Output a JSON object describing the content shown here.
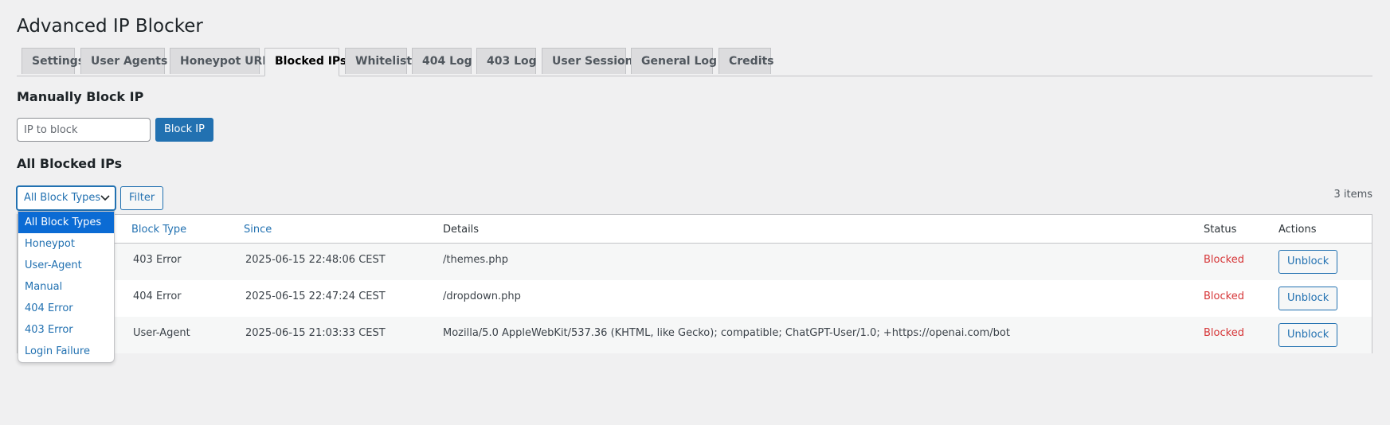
{
  "page_title": "Advanced IP Blocker",
  "tabs": [
    {
      "label": "Settings",
      "active": false
    },
    {
      "label": "User Agents",
      "active": false
    },
    {
      "label": "Honeypot URLs",
      "active": false
    },
    {
      "label": "Blocked IPs",
      "active": true
    },
    {
      "label": "Whitelist",
      "active": false
    },
    {
      "label": "404 Log",
      "active": false
    },
    {
      "label": "403 Log",
      "active": false
    },
    {
      "label": "User Sessions",
      "active": false
    },
    {
      "label": "General Log",
      "active": false
    },
    {
      "label": "Credits",
      "active": false
    }
  ],
  "manual_block": {
    "heading": "Manually Block IP",
    "input_placeholder": "IP to block",
    "input_value": "",
    "button_label": "Block IP"
  },
  "blocked_list": {
    "heading": "All Blocked IPs",
    "filter_select": {
      "selected": "All Block Types",
      "options": [
        "All Block Types",
        "Honeypot",
        "User-Agent",
        "Manual",
        "404 Error",
        "403 Error",
        "Login Failure"
      ]
    },
    "filter_button": "Filter",
    "items_count": "3 items",
    "columns": {
      "block_type": "Block Type",
      "since": "Since",
      "details": "Details",
      "status": "Status",
      "actions": "Actions"
    },
    "rows": [
      {
        "block_type": "403 Error",
        "since": "2025-06-15 22:48:06 CEST",
        "details": "/themes.php",
        "status": "Blocked",
        "action": "Unblock"
      },
      {
        "block_type": "404 Error",
        "since": "2025-06-15 22:47:24 CEST",
        "details": "/dropdown.php",
        "status": "Blocked",
        "action": "Unblock"
      },
      {
        "block_type": "User-Agent",
        "since": "2025-06-15 21:03:33 CEST",
        "details": "Mozilla/5.0 AppleWebKit/537.36 (KHTML, like Gecko); compatible; ChatGPT-User/1.0; +https://openai.com/bot",
        "status": "Blocked",
        "action": "Unblock"
      }
    ]
  },
  "colors": {
    "accent": "#2271b1",
    "blocked": "#d63638",
    "selected_option": "#0b6bd4"
  }
}
